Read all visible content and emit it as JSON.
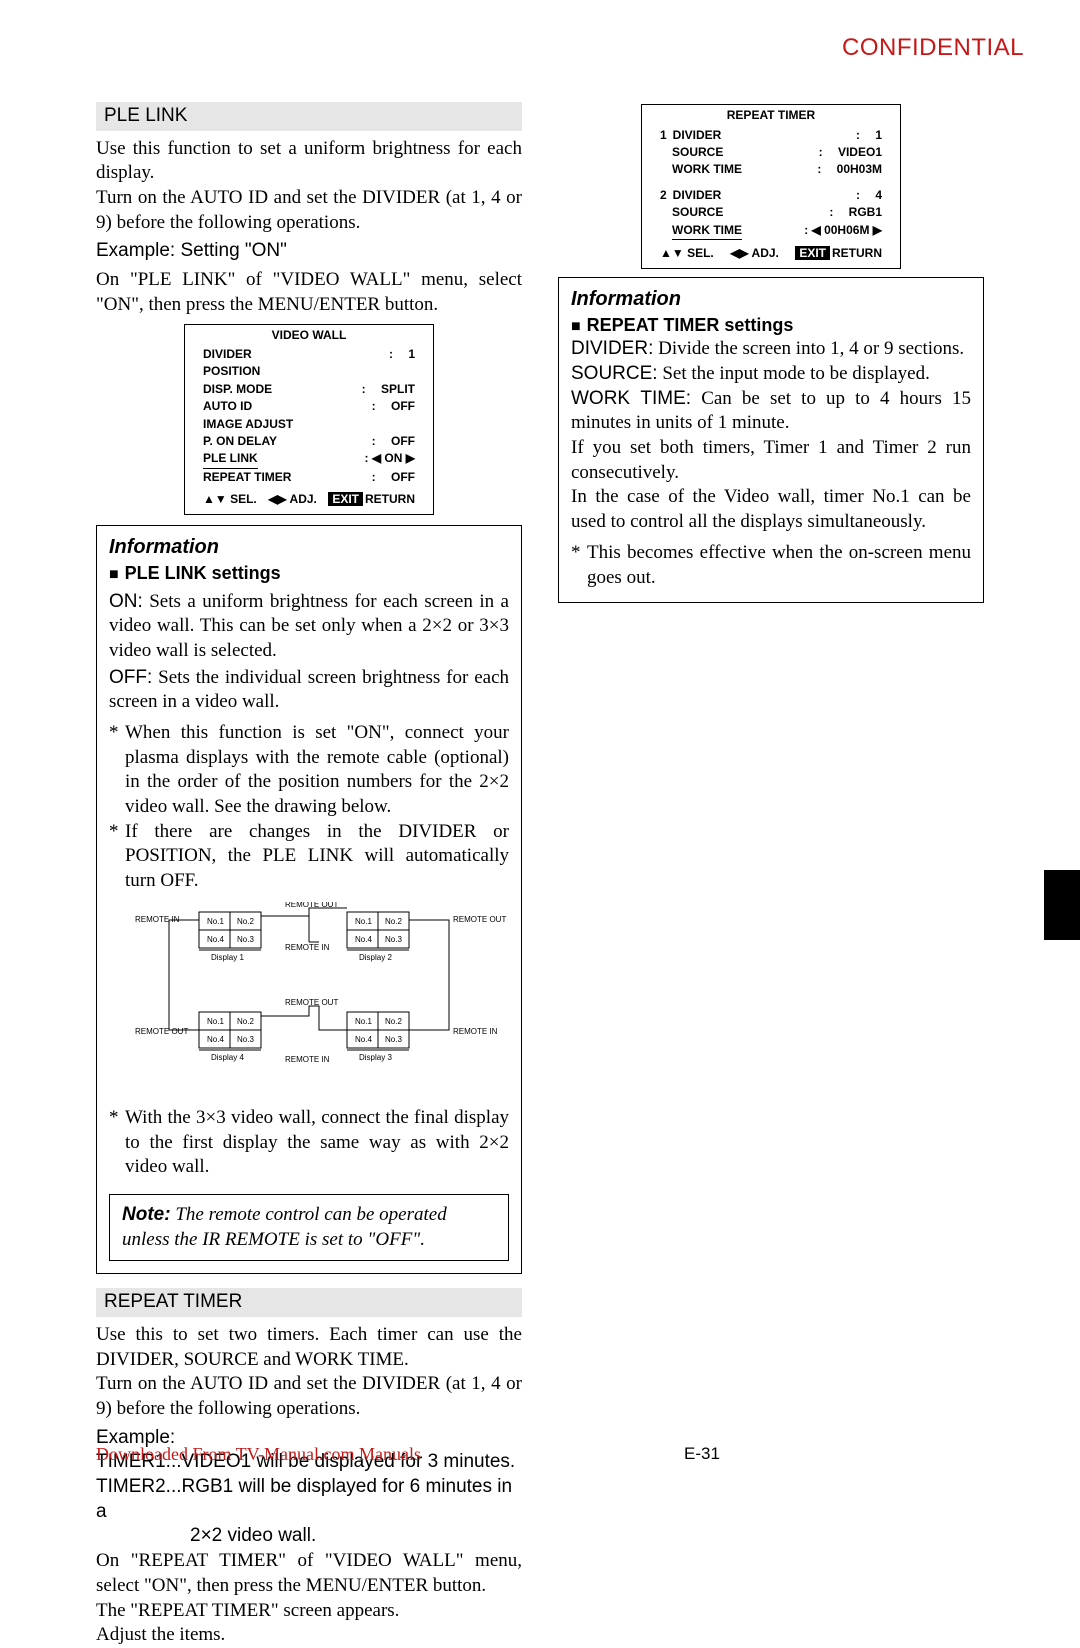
{
  "watermark": "CONFIDENTIAL",
  "footer": {
    "download": "Downloaded From TV-Manual.com Manuals",
    "page": "E-31"
  },
  "col_left": {
    "ple_link_title": "PLE LINK",
    "ple_link_body1": "Use this function to set a uniform brightness for each display.",
    "ple_link_body2": "Turn on the AUTO ID and set the DIVIDER (at 1, 4 or 9) before the following operations.",
    "example_label": "Example: Setting \"ON\"",
    "ple_link_body3": "On \"PLE LINK\" of \"VIDEO WALL\" menu, select \"ON\", then press the MENU/ENTER button.",
    "osd_videowall": {
      "title": "VIDEO WALL",
      "rows": [
        {
          "l": "DIVIDER",
          "r": ":  1"
        },
        {
          "l": "POSITION",
          "r": ""
        },
        {
          "l": "DISP. MODE",
          "r": ":  SPLIT"
        },
        {
          "l": "AUTO ID",
          "r": ":  OFF"
        },
        {
          "l": "IMAGE ADJUST",
          "r": ""
        },
        {
          "l": "P. ON DELAY",
          "r": ":  OFF"
        },
        {
          "l": "PLE LINK",
          "r": ": ◀ ON  ▶",
          "under": true
        },
        {
          "l": "REPEAT TIMER",
          "r": ":  OFF"
        }
      ],
      "footer": {
        "sel": "SEL.",
        "adj": "ADJ.",
        "exit": "EXIT",
        "ret": "RETURN",
        "up": "▲",
        "down": "▼",
        "left": "◀",
        "right": "▶"
      }
    },
    "info_ple": {
      "heading": "Information",
      "sub": "PLE LINK settings",
      "on": "ON:",
      "on_txt": " Sets a uniform brightness for each screen in a video wall. This can be set only when a 2×2 or 3×3 video wall is selected.",
      "off": "OFF:",
      "off_txt": " Sets the individual screen brightness for each screen in a video wall.",
      "ast": [
        "When this function is set \"ON\", connect your plasma displays with the remote cable (optional) in the order of the position numbers for the 2×2 video wall. See the drawing below.",
        "If there are changes in the DIVIDER or POSITION, the PLE LINK will automatically turn OFF."
      ],
      "ast2": "With the 3×3 video wall, connect the final display to the first display the same way as with 2×2 video wall.",
      "diagram": {
        "labels": {
          "rin": "REMOTE IN",
          "rout": "REMOTE OUT",
          "d1": "Display 1",
          "d2": "Display 2",
          "d3": "Display 3",
          "d4": "Display 4",
          "n1": "No.1",
          "n2": "No.2",
          "n3": "No.3",
          "n4": "No.4"
        }
      }
    },
    "note": {
      "label": "Note:",
      "text": " The remote control can be operated unless the IR REMOTE is set to \"OFF\"."
    },
    "repeat_title": "REPEAT TIMER",
    "repeat_body1": "Use this to set two timers. Each timer can use the DIVIDER, SOURCE and WORK TIME.",
    "repeat_body2": "Turn on the AUTO ID and set the DIVIDER (at 1, 4 or 9) before the following operations.",
    "repeat_example": "Example:",
    "repeat_t1": "TIMER1...VIDEO1 will be displayed for 3 minutes.",
    "repeat_t2a": "TIMER2...RGB1 will be displayed for 6 minutes in a",
    "repeat_t2b": "2×2 video wall.",
    "repeat_body3": "On \"REPEAT TIMER\" of \"VIDEO WALL\" menu, select \"ON\", then press the MENU/ENTER button.",
    "repeat_body4": "The \"REPEAT TIMER\" screen appears.",
    "repeat_body5": "Adjust the items."
  },
  "col_right": {
    "osd_repeat": {
      "title": "REPEAT TIMER",
      "groups": [
        {
          "head": "1",
          "rows": [
            {
              "l": "DIVIDER",
              "r": ":  1"
            },
            {
              "l": "SOURCE",
              "r": ":  VIDEO1"
            },
            {
              "l": "WORK TIME",
              "r": ":  00H03M"
            }
          ]
        },
        {
          "head": "2",
          "rows": [
            {
              "l": "DIVIDER",
              "r": ":  4"
            },
            {
              "l": "SOURCE",
              "r": ":  RGB1"
            },
            {
              "l": "WORK TIME",
              "r": ": ◀ 00H06M ▶",
              "under": true
            }
          ]
        }
      ],
      "footer": {
        "sel": "SEL.",
        "adj": "ADJ.",
        "exit": "EXIT",
        "ret": "RETURN"
      }
    },
    "info_repeat": {
      "heading": "Information",
      "sub": "REPEAT TIMER settings",
      "divider": "DIVIDER:",
      "divider_txt": " Divide the screen into 1, 4 or 9 sections.",
      "source": "SOURCE:",
      "source_txt": " Set the input mode to be displayed.",
      "work": "WORK TIME:",
      "work_txt": " Can be set to up to 4 hours 15 minutes in units of 1 minute.",
      "p1": "If you set both timers, Timer 1 and Timer 2 run consecutively.",
      "p2": "In the case of the Video wall, timer No.1 can be used to control all the displays simultaneously.",
      "ast": "This becomes effective when the on-screen menu goes out."
    }
  }
}
